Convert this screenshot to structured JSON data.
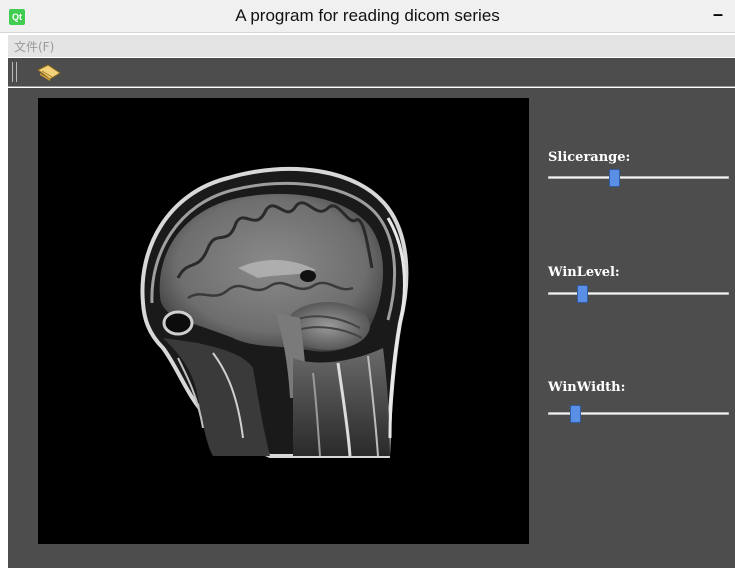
{
  "window": {
    "title": "A program for reading dicom series",
    "icon_text": "Qt",
    "minimize_glyph": "–"
  },
  "menu": {
    "items": [
      {
        "label": "文件(F)"
      }
    ]
  },
  "toolbar": {
    "actions": [
      {
        "icon": "open-folder-icon"
      }
    ]
  },
  "controls": {
    "slicerange": {
      "label": "Slicerange:",
      "position": 0.36
    },
    "winlevel": {
      "label": "WinLevel:",
      "position": 0.17
    },
    "winwidth": {
      "label": "WinWidth:",
      "position": 0.13
    }
  },
  "colors": {
    "panel_bg": "#4d4d4d",
    "slider_handle": "#5b8fe6",
    "viewer_bg": "#000000"
  }
}
